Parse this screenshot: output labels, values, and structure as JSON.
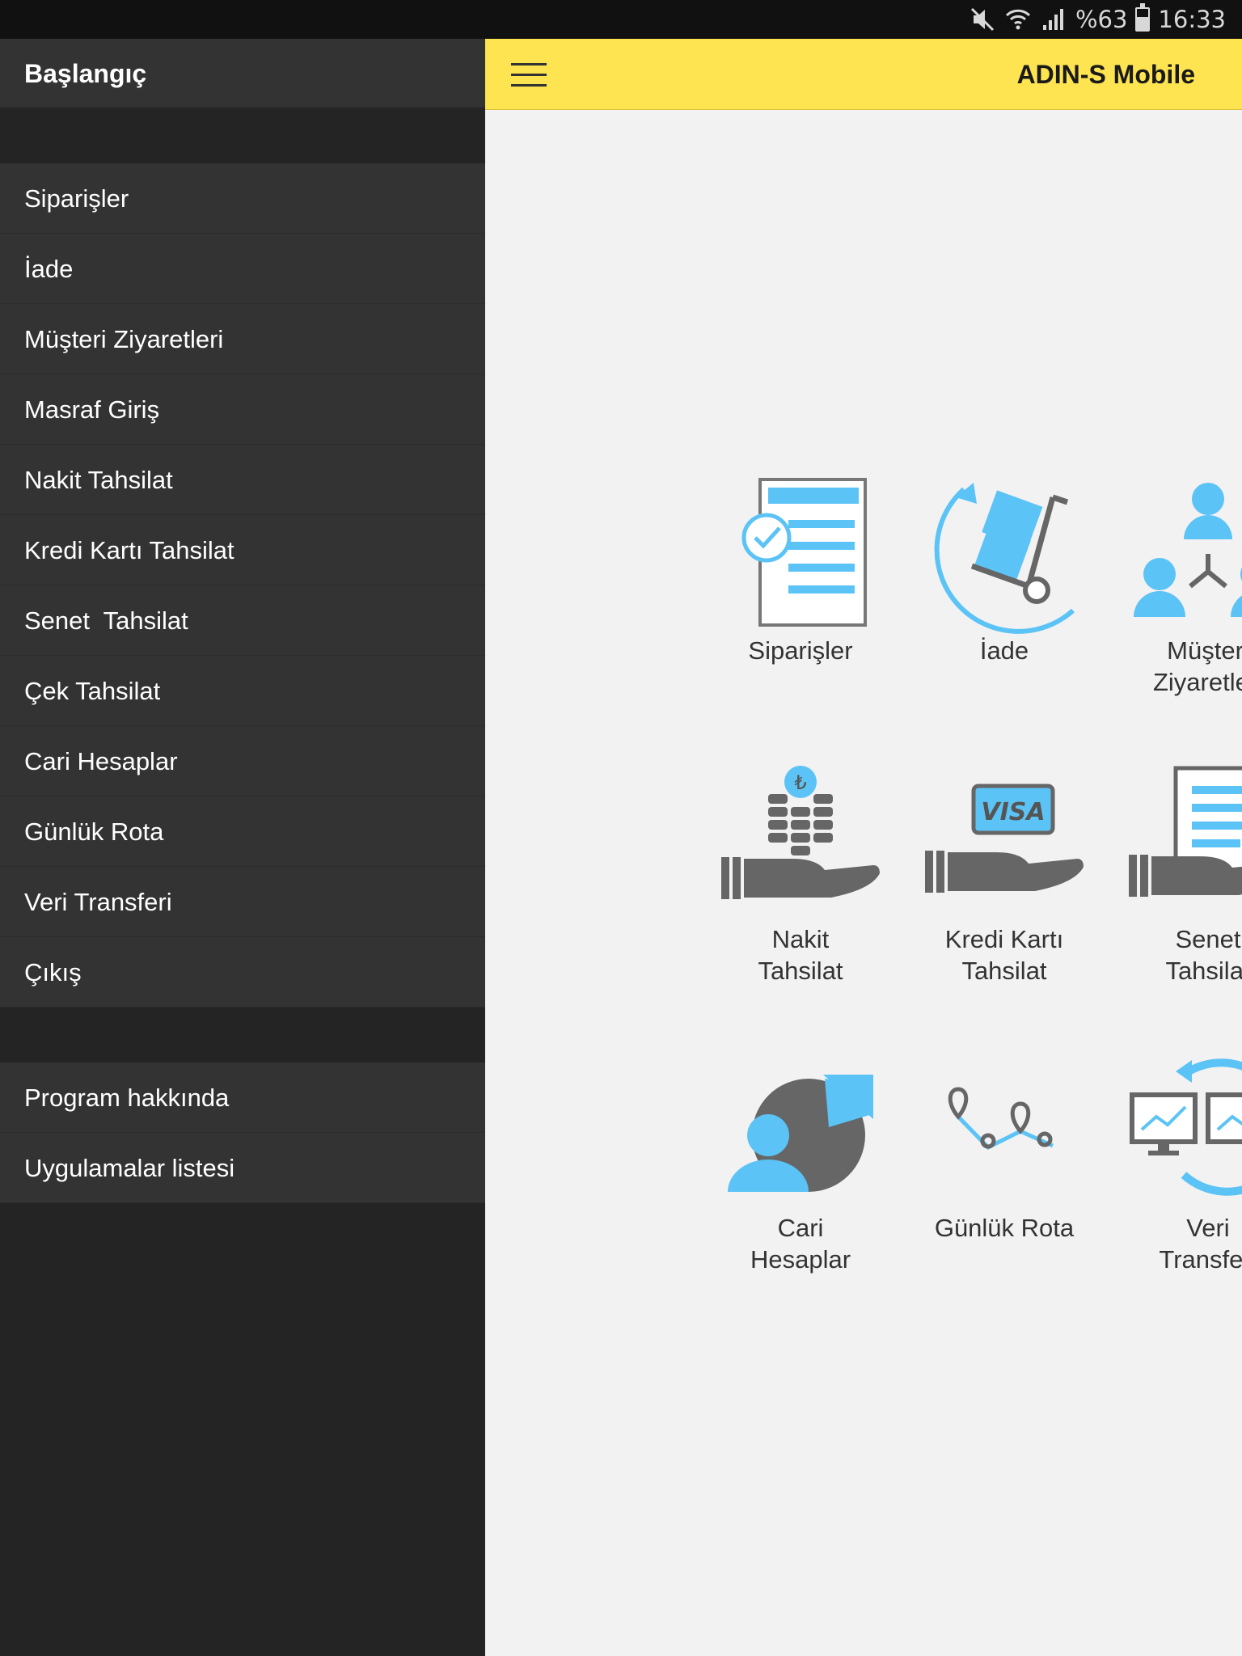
{
  "status_bar": {
    "battery_text": "%63",
    "time": "16:33",
    "icons": [
      "mute-icon",
      "wifi-icon",
      "signal-icon",
      "battery-icon"
    ],
    "battery_level": 0.63
  },
  "app_bar": {
    "title": "ADIN-S Mobile",
    "menu_icon": "hamburger-icon"
  },
  "drawer": {
    "header": "Başlangıç",
    "items": [
      {
        "label": "Siparişler"
      },
      {
        "label": "İade"
      },
      {
        "label": "Müşteri Ziyaretleri"
      },
      {
        "label": "Masraf Giriş"
      },
      {
        "label": "Nakit Tahsilat"
      },
      {
        "label": "Kredi Kartı Tahsilat"
      },
      {
        "label": "Senet  Tahsilat"
      },
      {
        "label": "Çek Tahsilat"
      },
      {
        "label": "Cari Hesaplar"
      },
      {
        "label": "Günlük Rota"
      },
      {
        "label": "Veri Transferi"
      },
      {
        "label": "Çıkış"
      }
    ],
    "footer_items": [
      {
        "label": "Program hakkında"
      },
      {
        "label": "Uygulamalar listesi"
      }
    ]
  },
  "grid": {
    "tiles": [
      {
        "label": "Siparişler",
        "icon": "order-list-icon"
      },
      {
        "label": "İade",
        "icon": "return-cart-icon"
      },
      {
        "label": "Müşteri\nZiyaretleri",
        "icon": "customer-visit-icon"
      },
      {
        "label": "Nakit\nTahsilat",
        "icon": "cash-collection-icon"
      },
      {
        "label": "Kredi Kartı\nTahsilat",
        "icon": "credit-card-icon"
      },
      {
        "label": "Senet\nTahsilat",
        "icon": "promissory-note-icon"
      },
      {
        "label": "Cari\nHesaplar",
        "icon": "accounts-pie-icon"
      },
      {
        "label": "Günlük Rota",
        "icon": "route-icon"
      },
      {
        "label": "Veri\nTransferi",
        "icon": "data-transfer-icon"
      }
    ],
    "visa_text": "VISA"
  },
  "colors": {
    "accent_yellow": "#fde450",
    "icon_blue": "#5bc3f5",
    "icon_gray": "#666666",
    "drawer_bg": "#242424",
    "drawer_item_bg": "#333333"
  }
}
